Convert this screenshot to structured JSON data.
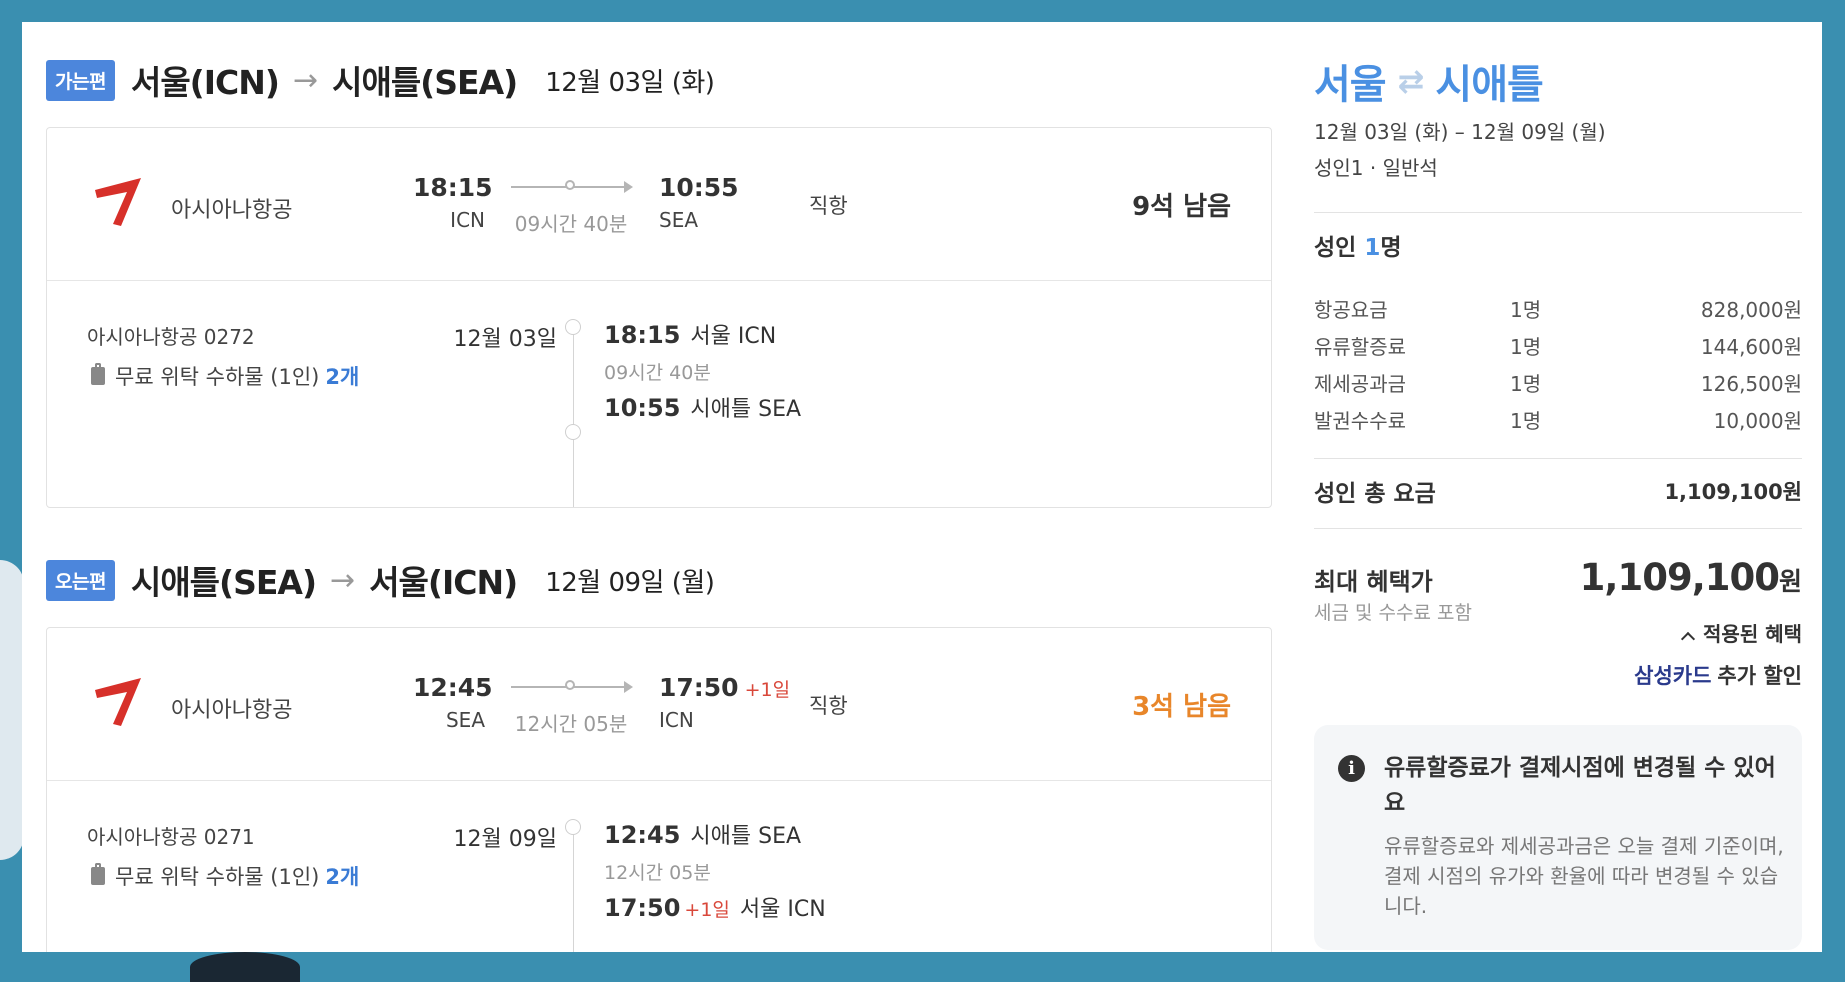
{
  "outbound": {
    "badge": "가는편",
    "from": "서울(ICN)",
    "to": "시애틀(SEA)",
    "arrow": "→",
    "date": "12월 03일 (화)",
    "airline": "아시아나항공",
    "dep_time": "18:15",
    "dep_code": "ICN",
    "duration": "09시간 40분",
    "arr_time": "10:55",
    "arr_plus": "",
    "arr_code": "SEA",
    "direct": "직항",
    "seats": "9석 남음",
    "seats_color": "#333333",
    "flight_no": "아시아나항공 0272",
    "baggage": "무료 위탁 수하물 (1인)",
    "baggage_count": "2개",
    "detail_date": "12월 03일",
    "detail_dep_time": "18:15",
    "detail_dep_place": "서울 ICN",
    "detail_duration": "09시간 40분",
    "detail_arr_time": "10:55",
    "detail_arr_plus": "",
    "detail_arr_place": "시애틀 SEA"
  },
  "inbound": {
    "badge": "오는편",
    "from": "시애틀(SEA)",
    "to": "서울(ICN)",
    "arrow": "→",
    "date": "12월 09일 (월)",
    "airline": "아시아나항공",
    "dep_time": "12:45",
    "dep_code": "SEA",
    "duration": "12시간 05분",
    "arr_time": "17:50",
    "arr_plus": "+1일",
    "arr_code": "ICN",
    "direct": "직항",
    "seats": "3석 남음",
    "seats_color": "#e8862a",
    "flight_no": "아시아나항공 0271",
    "baggage": "무료 위탁 수하물 (1인)",
    "baggage_count": "2개",
    "detail_date": "12월 09일",
    "detail_dep_time": "12:45",
    "detail_dep_place": "시애틀 SEA",
    "detail_duration": "12시간 05분",
    "detail_arr_time": "17:50",
    "detail_arr_plus": "+1일",
    "detail_arr_place": "서울 ICN"
  },
  "summary": {
    "title_from": "서울",
    "swap": "⇄",
    "title_to": "시애틀",
    "dates": "12월 03일 (화) – 12월 09일 (월)",
    "pax": "성인1 · 일반석",
    "adult_label": "성인",
    "adult_count": "1",
    "adult_unit": "명",
    "fees": [
      {
        "name": "항공요금",
        "count": "1명",
        "value": "828,000원"
      },
      {
        "name": "유류할증료",
        "count": "1명",
        "value": "144,600원"
      },
      {
        "name": "제세공과금",
        "count": "1명",
        "value": "126,500원"
      },
      {
        "name": "발권수수료",
        "count": "1명",
        "value": "10,000원"
      }
    ],
    "total_label": "성인 총 요금",
    "total_value": "1,109,100원",
    "best_label": "최대 혜택가",
    "best_sub": "세금 및 수수료 포함",
    "best_value": "1,109,100",
    "best_unit": "원",
    "benefit_toggle": "적용된 혜택",
    "card_name": "삼성카드",
    "card_text": "추가 할인",
    "notice_title": "유류할증료가 결제시점에 변경될 수 있어요",
    "notice_body": "유류할증료와 제세공과금은 오늘 결제 기준이며, 결제 시점의 유가와 환율에 따라 변경될 수 있습니다."
  },
  "colors": {
    "badge": "#4c86dc",
    "accent": "#4a90e2",
    "warning": "#e8862a",
    "plus_day": "#d9483b",
    "card_brand": "#2a3a8c"
  },
  "icons": {
    "airline_logo": "asiana-logo-icon",
    "baggage": "luggage-icon",
    "info": "info-icon",
    "benefit_toggle": "chevron-up-icon"
  }
}
